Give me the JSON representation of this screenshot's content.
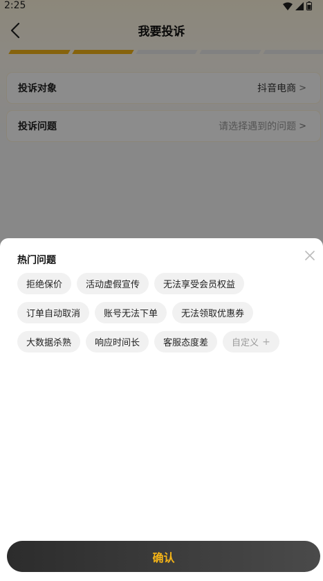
{
  "status_bar": {
    "time": "2:25",
    "icons": [
      "wifi-icon",
      "signal-icon",
      "battery-icon"
    ]
  },
  "nav": {
    "title": "我要投诉",
    "back_icon": "chevron-left-icon"
  },
  "progress": {
    "steps_total": 5,
    "steps_active": 2,
    "active_color": "#f5b417"
  },
  "form": {
    "target": {
      "label": "投诉对象",
      "value": "抖音电商"
    },
    "issue": {
      "label": "投诉问题",
      "placeholder": "请选择遇到的问题"
    }
  },
  "sheet": {
    "title": "热门问题",
    "close_icon": "close-icon",
    "tag_rows": [
      [
        "拒绝保价",
        "活动虚假宣传",
        "无法享受会员权益"
      ],
      [
        "订单自动取消",
        "账号无法下单",
        "无法领取优惠券"
      ],
      [
        "大数据杀熟",
        "响应时间长",
        "客服态度差"
      ]
    ],
    "custom_tag": "自定义",
    "custom_tag_icon": "+"
  },
  "confirm_button": {
    "label": "确认",
    "text_color": "#f5b417"
  }
}
